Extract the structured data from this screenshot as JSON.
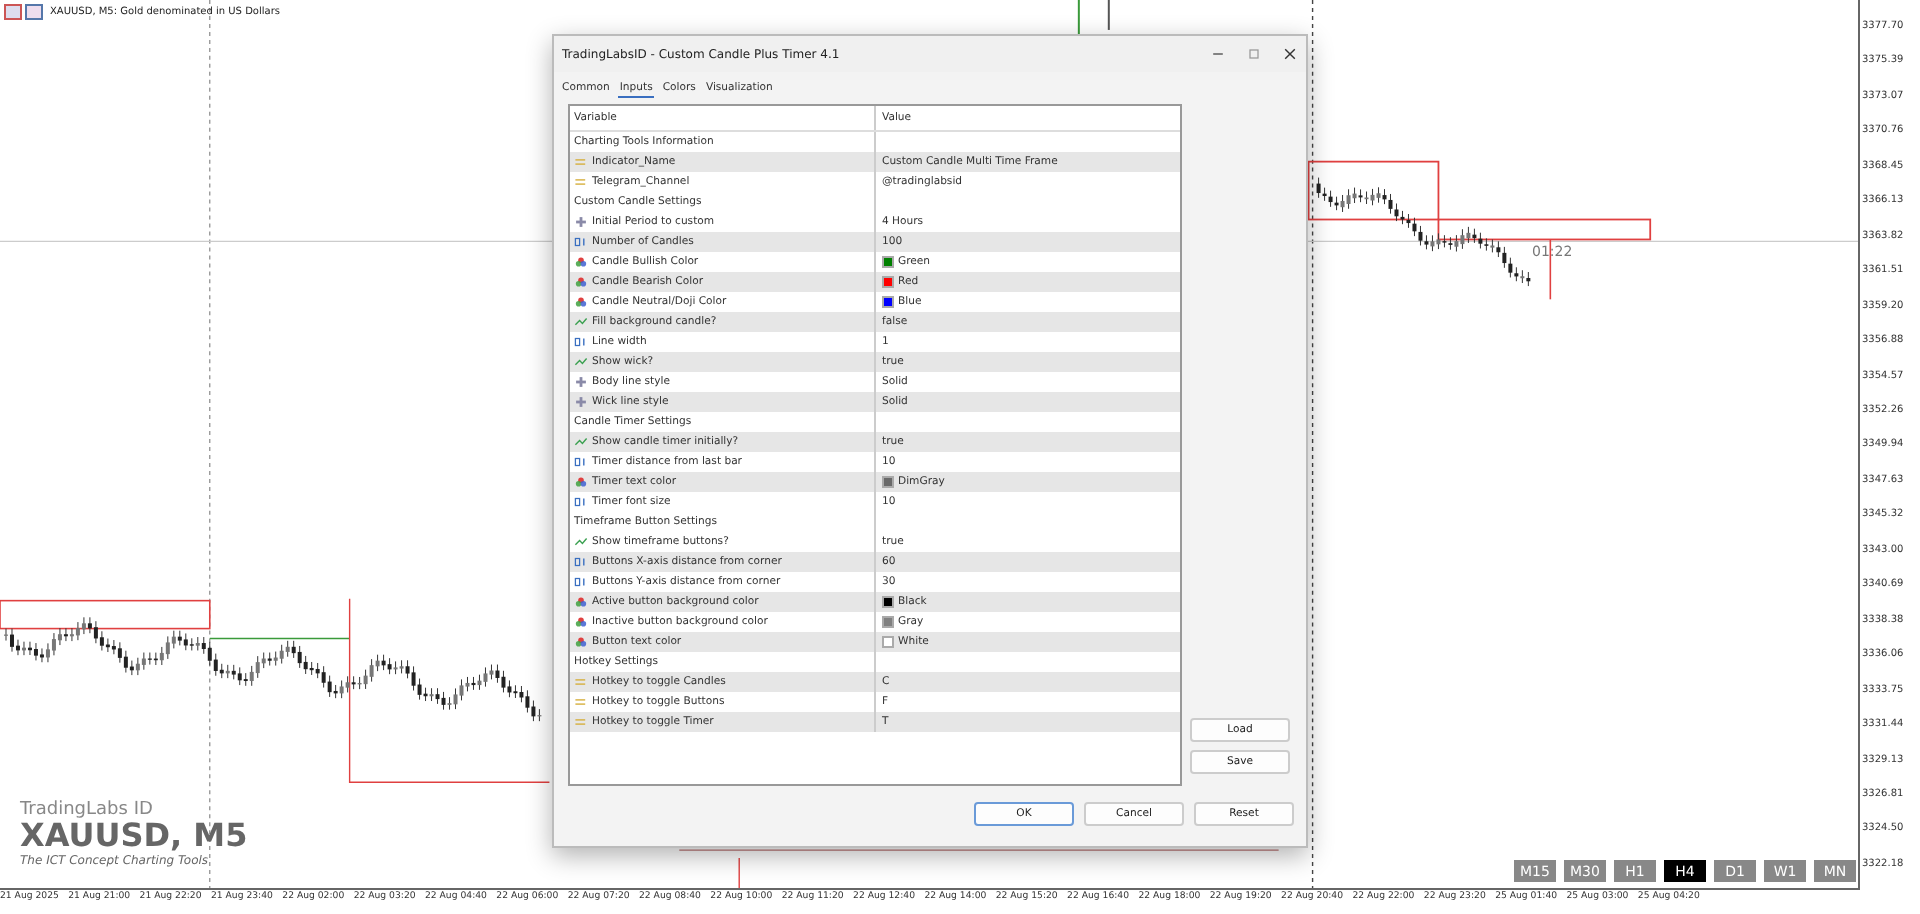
{
  "chart": {
    "symbol_caption": "XAUUSD, M5:  Gold denominated in US Dollars",
    "watermark": {
      "brand": "TradingLabs ID",
      "symbol": "XAUUSD, M5",
      "tagline": "The ICT Concept Charting Tools"
    },
    "timer_label": "01:22",
    "price_axis": [
      "3377.70",
      "3375.39",
      "3373.07",
      "3370.76",
      "3368.45",
      "3366.13",
      "3363.82",
      "3361.51",
      "3359.20",
      "3356.88",
      "3354.57",
      "3352.26",
      "3349.94",
      "3347.63",
      "3345.32",
      "3343.00",
      "3340.69",
      "3338.38",
      "3336.06",
      "3333.75",
      "3331.44",
      "3329.13",
      "3326.81",
      "3324.50",
      "3322.18"
    ],
    "time_axis": [
      "21 Aug 2025",
      "21 Aug 21:00",
      "21 Aug 22:20",
      "21 Aug 23:40",
      "22 Aug 02:00",
      "22 Aug 03:20",
      "22 Aug 04:40",
      "22 Aug 06:00",
      "22 Aug 07:20",
      "22 Aug 08:40",
      "22 Aug 10:00",
      "22 Aug 11:20",
      "22 Aug 12:40",
      "22 Aug 14:00",
      "22 Aug 15:20",
      "22 Aug 16:40",
      "22 Aug 18:00",
      "22 Aug 19:20",
      "22 Aug 20:40",
      "22 Aug 22:00",
      "22 Aug 23:20",
      "25 Aug 01:40",
      "25 Aug 03:00",
      "25 Aug 04:20"
    ],
    "timeframes": [
      {
        "label": "M15",
        "selected": false
      },
      {
        "label": "M30",
        "selected": false
      },
      {
        "label": "H1",
        "selected": false
      },
      {
        "label": "H4",
        "selected": true
      },
      {
        "label": "D1",
        "selected": false
      },
      {
        "label": "W1",
        "selected": false
      },
      {
        "label": "MN",
        "selected": false
      }
    ]
  },
  "dialog": {
    "title": "TradingLabsID - Custom Candle Plus Timer 4.1",
    "tabs": [
      {
        "label": "Common",
        "selected": false
      },
      {
        "label": "Inputs",
        "selected": true
      },
      {
        "label": "Colors",
        "selected": false
      },
      {
        "label": "Visualization",
        "selected": false
      }
    ],
    "columns": [
      "Variable",
      "Value"
    ],
    "rows": [
      {
        "kind": "section",
        "label": "Charting Tools Information"
      },
      {
        "kind": "text",
        "label": "Indicator_Name",
        "value": "Custom Candle Multi Time Frame"
      },
      {
        "kind": "text",
        "label": "Telegram_Channel",
        "value": "@tradinglabsid"
      },
      {
        "kind": "section",
        "label": "Custom Candle Settings"
      },
      {
        "kind": "enum",
        "label": "Initial Period to custom",
        "value": "4 Hours"
      },
      {
        "kind": "int",
        "label": "Number of Candles",
        "value": "100"
      },
      {
        "kind": "color",
        "label": "Candle Bullish Color",
        "value": "Green",
        "color": "#008000"
      },
      {
        "kind": "color",
        "label": "Candle Bearish Color",
        "value": "Red",
        "color": "#ff0000"
      },
      {
        "kind": "color",
        "label": "Candle Neutral/Doji Color",
        "value": "Blue",
        "color": "#0000ff"
      },
      {
        "kind": "bool",
        "label": "Fill background candle?",
        "value": "false"
      },
      {
        "kind": "int",
        "label": "Line width",
        "value": "1"
      },
      {
        "kind": "bool",
        "label": "Show wick?",
        "value": "true"
      },
      {
        "kind": "enum",
        "label": "Body line style",
        "value": "Solid"
      },
      {
        "kind": "enum",
        "label": "Wick line style",
        "value": "Solid"
      },
      {
        "kind": "section",
        "label": "Candle Timer Settings"
      },
      {
        "kind": "bool",
        "label": "Show candle timer initially?",
        "value": "true"
      },
      {
        "kind": "int",
        "label": "Timer distance from last bar",
        "value": "10"
      },
      {
        "kind": "color",
        "label": "Timer text color",
        "value": "DimGray",
        "color": "#696969"
      },
      {
        "kind": "int",
        "label": "Timer font size",
        "value": "10"
      },
      {
        "kind": "section",
        "label": "Timeframe Button Settings"
      },
      {
        "kind": "bool",
        "label": "Show timeframe buttons?",
        "value": "true"
      },
      {
        "kind": "int",
        "label": "Buttons X-axis distance from corner",
        "value": "60"
      },
      {
        "kind": "int",
        "label": "Buttons Y-axis distance from corner",
        "value": "30"
      },
      {
        "kind": "color",
        "label": "Active button background color",
        "value": "Black",
        "color": "#000000"
      },
      {
        "kind": "color",
        "label": "Inactive button background color",
        "value": "Gray",
        "color": "#808080"
      },
      {
        "kind": "color",
        "label": "Button text color",
        "value": "White",
        "color": "#ffffff"
      },
      {
        "kind": "section",
        "label": "Hotkey Settings"
      },
      {
        "kind": "text",
        "label": "Hotkey to toggle Candles",
        "value": "C"
      },
      {
        "kind": "text",
        "label": "Hotkey to toggle Buttons",
        "value": "F"
      },
      {
        "kind": "text",
        "label": "Hotkey to toggle Timer",
        "value": "T"
      }
    ],
    "side_buttons": [
      "Load",
      "Save"
    ],
    "footer_buttons": [
      "OK",
      "Cancel",
      "Reset"
    ]
  }
}
